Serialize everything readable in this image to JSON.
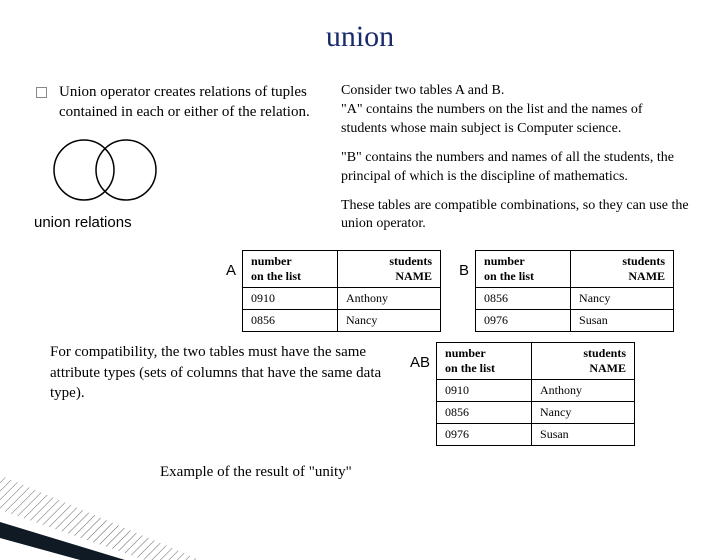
{
  "title": "union",
  "bullet_text": "Union operator creates relations of tuples contained in each or either of the relation.",
  "right_paragraphs": {
    "p1": "Consider two tables A and B.\n\"A\" contains the numbers on the list and the names of students whose main subject is Computer science.",
    "p2": "\"B\" contains the numbers and names of all the students, the principal of which is the discipline of mathematics.",
    "p3": "These tables are compatible combinations, so they can use the union operator."
  },
  "venn_caption": "union relations",
  "table_headers": {
    "col1_line1": "number",
    "col1_line2": "on the list",
    "col2_line1": "students",
    "col2_line2": "NAME"
  },
  "tables": {
    "A": {
      "label": "A",
      "rows": [
        {
          "num": "0910",
          "name": "Anthony"
        },
        {
          "num": "0856",
          "name": "Nancy"
        }
      ]
    },
    "B": {
      "label": "B",
      "rows": [
        {
          "num": "0856",
          "name": "Nancy"
        },
        {
          "num": "0976",
          "name": "Susan"
        }
      ]
    },
    "AB": {
      "label": "AB",
      "rows": [
        {
          "num": "0910",
          "name": "Anthony"
        },
        {
          "num": "0856",
          "name": "Nancy"
        },
        {
          "num": "0976",
          "name": "Susan"
        }
      ]
    }
  },
  "compat_text": "For compatibility, the two tables must have the same attribute types (sets of columns that have the same data type).",
  "example_caption": "Example of the result of \"unity\""
}
